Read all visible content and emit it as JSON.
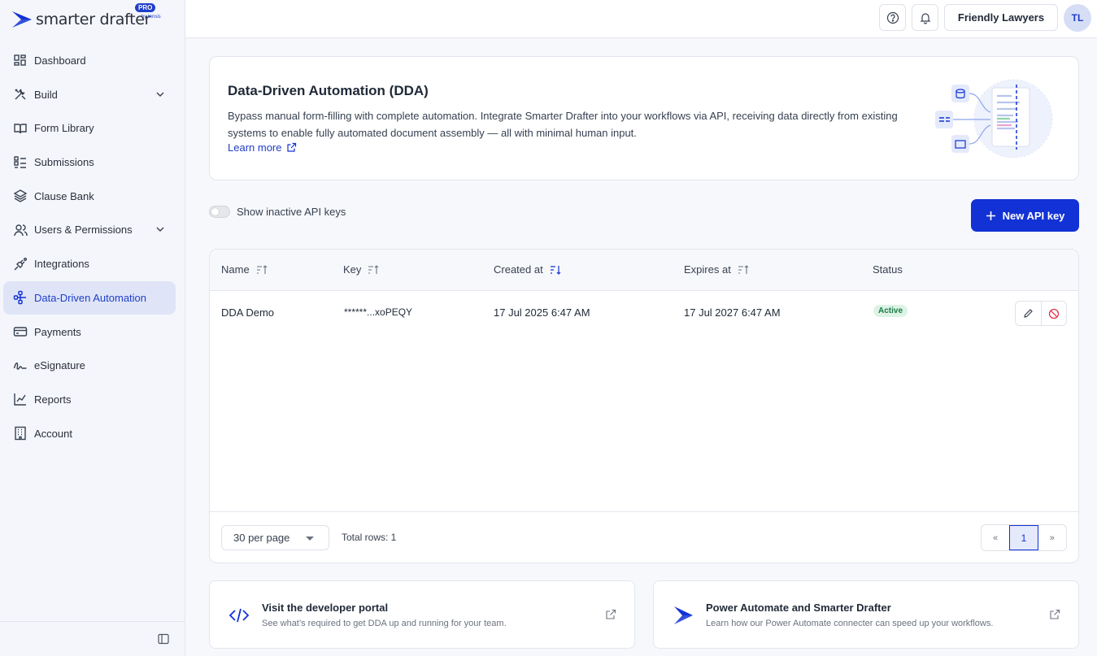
{
  "app": {
    "logo_text": "smarter drafter",
    "logo_badge": "PRO",
    "logo_byline": "by tensis"
  },
  "sidebar": {
    "items": [
      {
        "label": "Dashboard",
        "icon": "grid-icon"
      },
      {
        "label": "Build",
        "icon": "tools-icon",
        "expandable": true
      },
      {
        "label": "Form Library",
        "icon": "book-icon"
      },
      {
        "label": "Submissions",
        "icon": "checklist-icon"
      },
      {
        "label": "Clause Bank",
        "icon": "layers-icon"
      },
      {
        "label": "Users & Permissions",
        "icon": "users-icon",
        "expandable": true
      },
      {
        "label": "Integrations",
        "icon": "plug-icon"
      },
      {
        "label": "Data-Driven Automation",
        "icon": "dda-icon",
        "active": true
      },
      {
        "label": "Payments",
        "icon": "card-icon"
      },
      {
        "label": "eSignature",
        "icon": "signature-icon"
      },
      {
        "label": "Reports",
        "icon": "chart-icon"
      },
      {
        "label": "Account",
        "icon": "building-icon"
      }
    ]
  },
  "topbar": {
    "org_name": "Friendly Lawyers",
    "avatar_initials": "TL"
  },
  "hero": {
    "title": "Data-Driven Automation (DDA)",
    "description": "Bypass manual form-filling with complete automation. Integrate Smarter Drafter into your workflows via API, receiving data directly from existing systems to enable fully automated document assembly — all with minimal human input.",
    "learn_more": "Learn more"
  },
  "controls": {
    "show_inactive_label": "Show inactive API keys",
    "show_inactive_on": false,
    "new_key_label": "New API key"
  },
  "table": {
    "columns": [
      "Name",
      "Key",
      "Created at",
      "Expires at",
      "Status"
    ],
    "sorted_column": "Created at",
    "rows": [
      {
        "name": "DDA Demo",
        "key": "******...xoPEQY",
        "created": "17 Jul 2025 6:47 AM",
        "expires": "17 Jul 2027 6:47 AM",
        "status": "Active"
      }
    ],
    "per_page": "30 per page",
    "total_rows": "Total rows: 1",
    "pager": {
      "prev": "«",
      "current": "1",
      "next": "»"
    }
  },
  "links": [
    {
      "title": "Visit the developer portal",
      "subtitle": "See what’s required to get DDA up and running for your team."
    },
    {
      "title": "Power Automate and Smarter Drafter",
      "subtitle": "Learn how our Power Automate connecter can speed up your workflows."
    }
  ],
  "colors": {
    "accent": "#1232d6",
    "active_bg": "#dfe5f7",
    "status_active_bg": "#dcf3e6",
    "status_active_text": "#1c7a46"
  }
}
